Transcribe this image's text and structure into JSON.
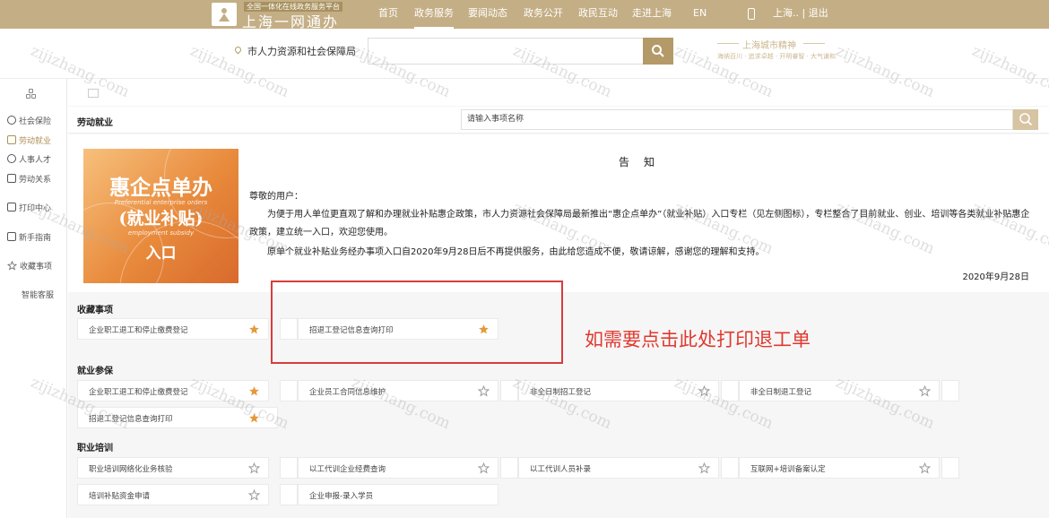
{
  "header": {
    "brand_sub": "全国一体化在线政务服务平台",
    "brand_name": "上海一网通办",
    "nav": [
      "首页",
      "政务服务",
      "要闻动态",
      "政务公开",
      "政民互动",
      "走进上海",
      "EN"
    ],
    "active_nav": "政务服务",
    "user_text": "上海..  |  退出",
    "colors": {
      "topbar": "#c4ae85",
      "accent": "#b49a68"
    }
  },
  "searchband": {
    "location": "市人力资源和社会保障局",
    "search_value": "",
    "spirit_title": "上海城市精神",
    "spirit_sub": "海纳百川 · 追求卓越 · 开明睿智 · 大气谦和"
  },
  "sidebar": {
    "items": [
      {
        "label": "社会保险",
        "icon": "shield-icon"
      },
      {
        "label": "劳动就业",
        "icon": "briefcase-icon"
      },
      {
        "label": "人事人才",
        "icon": "person-icon"
      },
      {
        "label": "劳动关系",
        "icon": "document-icon"
      },
      {
        "label": "打印中心",
        "icon": "printer-icon"
      },
      {
        "label": "新手指南",
        "icon": "guide-icon"
      },
      {
        "label": "收藏事项",
        "icon": "star-icon"
      },
      {
        "label": "智能客服",
        "icon": ""
      }
    ],
    "active": "劳动就业"
  },
  "section": {
    "title": "劳动就业",
    "search_placeholder": "请输入事项名称"
  },
  "notice": {
    "title": "告知",
    "greeting": "尊敬的用户：",
    "p1": "为便于用人单位更直观了解和办理就业补贴惠企政策，市人力资源社会保障局最新推出“惠企点单办”（就业补贴）入口专栏（见左侧图标），专栏整合了目前就业、创业、培训等各类就业补贴惠企政策，建立统一入口，欢迎您使用。",
    "p2": "原单个就业补贴业务经办事项入口自2020年9月28日后不再提供服务，由此给您造成不便，敬请谅解，感谢您的理解和支持。",
    "date": "2020年9月28日",
    "banner": {
      "title": "惠企点单办",
      "en1": "Preferential enterprise orders",
      "sub": "(就业补贴)",
      "en2": "employment subsidy",
      "entry": "入口"
    }
  },
  "groups": [
    {
      "title": "收藏事项",
      "items": [
        {
          "label": "企业职工退工和停止缴费登记",
          "starred": true
        },
        {
          "label": "招退工登记信息查询打印",
          "starred": true
        }
      ]
    },
    {
      "title": "就业参保",
      "items": [
        {
          "label": "企业职工退工和停止缴费登记",
          "starred": true
        },
        {
          "label": "企业员工合同信息维护",
          "starred": false
        },
        {
          "label": "非全日制招工登记",
          "starred": false
        },
        {
          "label": "非全日制退工登记",
          "starred": false
        },
        {
          "label": "招退工登记信息查询打印",
          "starred": true
        }
      ]
    },
    {
      "title": "职业培训",
      "items": [
        {
          "label": "职业培训网络化业务核验",
          "starred": false
        },
        {
          "label": "以工代训企业经费查询",
          "starred": false
        },
        {
          "label": "以工代训人员补录",
          "starred": false
        },
        {
          "label": "互联网+培训备案认定",
          "starred": false
        },
        {
          "label": "培训补贴资金申请",
          "starred": false
        },
        {
          "label": "企业申报-录入学员",
          "starred": false
        }
      ]
    }
  ],
  "annotation": "如需要点击此处打印退工单",
  "watermark": "zijizhang.com"
}
